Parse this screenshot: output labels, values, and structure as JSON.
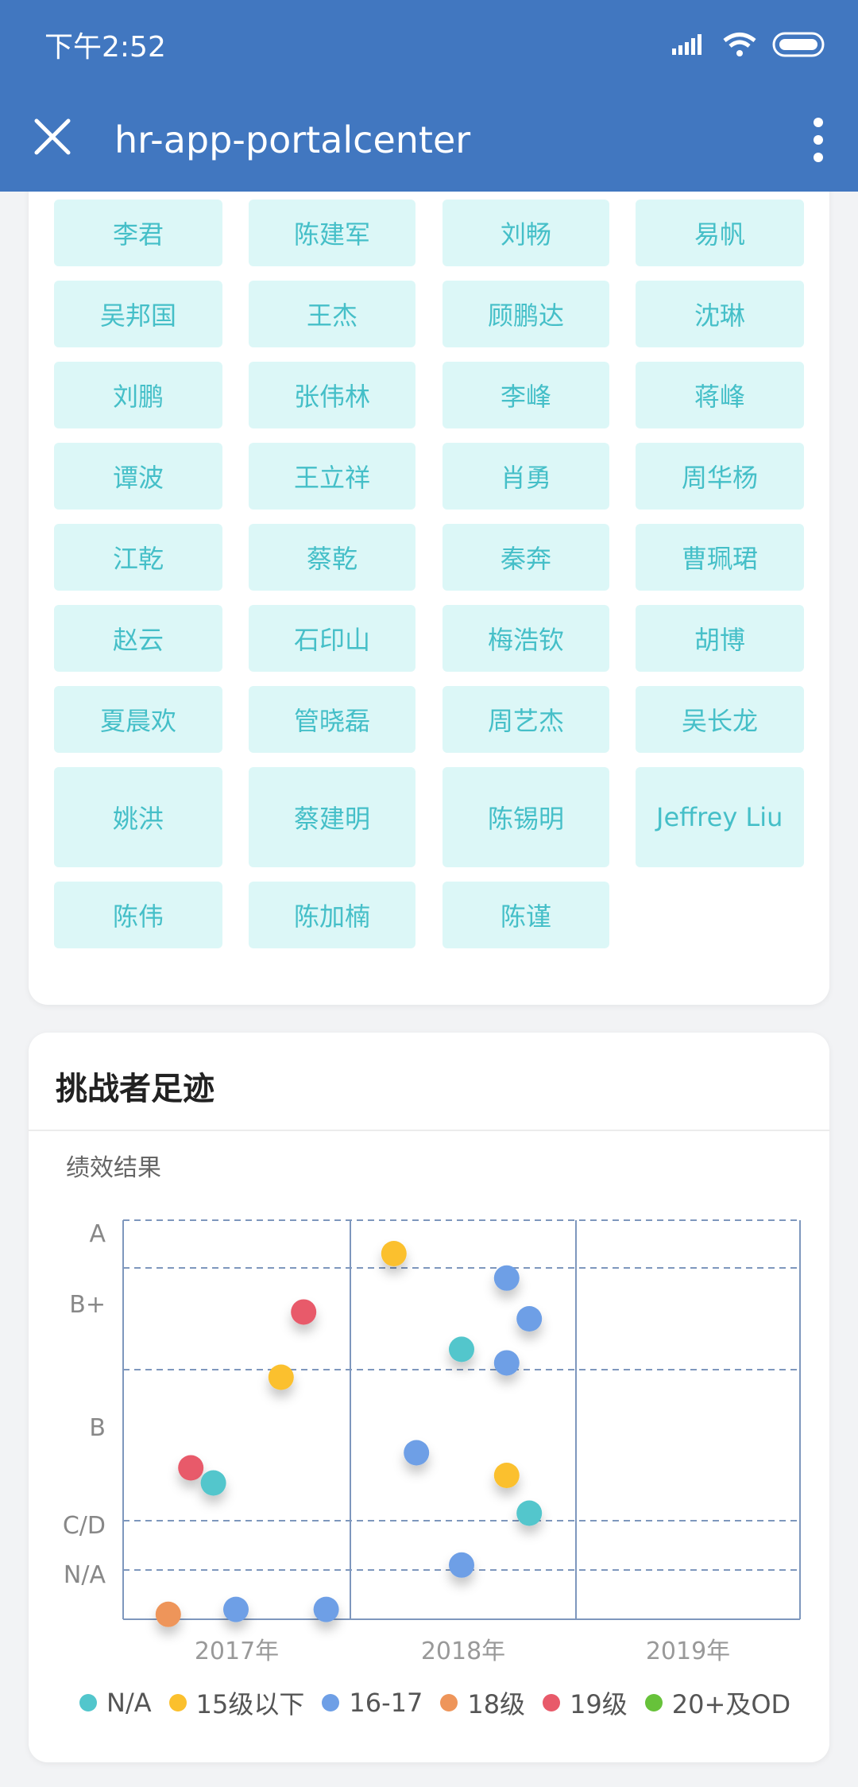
{
  "status_bar": {
    "time": "下午2:52"
  },
  "app_bar": {
    "title": "hr-app-portalcenter"
  },
  "people": {
    "rows": [
      [
        "李君",
        "陈建军",
        "刘畅",
        "易帆"
      ],
      [
        "吴邦国",
        "王杰",
        "顾鹏达",
        "沈琳"
      ],
      [
        "刘鹏",
        "张伟林",
        "李峰",
        "蒋峰"
      ],
      [
        "谭波",
        "王立祥",
        "肖勇",
        "周华杨"
      ],
      [
        "江乾",
        "蔡乾",
        "秦奔",
        "曹珮珺"
      ],
      [
        "赵云",
        "石印山",
        "梅浩钦",
        "胡博"
      ],
      [
        "夏晨欢",
        "管晓磊",
        "周艺杰",
        "吴长龙"
      ],
      [
        "姚洪",
        "蔡建明",
        "陈锡明",
        "Jeffrey Liu"
      ],
      [
        "陈伟",
        "陈加楠",
        "陈谨"
      ]
    ]
  },
  "section": {
    "title": "挑战者足迹"
  },
  "chart_data": {
    "type": "scatter",
    "ylabel": "绩效结果",
    "x_categories": [
      "2017年",
      "2018年",
      "2019年"
    ],
    "y_categories": [
      "N/A",
      "C/D",
      "B",
      "B+",
      "A"
    ],
    "legend": [
      {
        "name": "N/A",
        "color": "#52c6cc"
      },
      {
        "name": "15级以下",
        "color": "#fbc02d"
      },
      {
        "name": "16-17",
        "color": "#6e9fe6"
      },
      {
        "name": "18级",
        "color": "#ee955a"
      },
      {
        "name": "19级",
        "color": "#e85a6a"
      },
      {
        "name": "20+及OD",
        "color": "#67c23a"
      }
    ],
    "points": [
      {
        "x": 0.2,
        "y": 0.05,
        "series": "18级"
      },
      {
        "x": 0.5,
        "y": 0.1,
        "series": "16-17"
      },
      {
        "x": 0.9,
        "y": 0.1,
        "series": "16-17"
      },
      {
        "x": 0.3,
        "y": 1.35,
        "series": "19级"
      },
      {
        "x": 0.4,
        "y": 1.25,
        "series": "N/A"
      },
      {
        "x": 0.7,
        "y": 1.95,
        "series": "15级以下"
      },
      {
        "x": 0.8,
        "y": 2.85,
        "series": "19级"
      },
      {
        "x": 1.2,
        "y": 3.65,
        "series": "15级以下"
      },
      {
        "x": 1.3,
        "y": 1.45,
        "series": "16-17"
      },
      {
        "x": 1.5,
        "y": 0.55,
        "series": "16-17"
      },
      {
        "x": 1.5,
        "y": 2.3,
        "series": "N/A"
      },
      {
        "x": 1.7,
        "y": 3.35,
        "series": "16-17"
      },
      {
        "x": 1.8,
        "y": 2.75,
        "series": "16-17"
      },
      {
        "x": 1.7,
        "y": 2.1,
        "series": "16-17"
      },
      {
        "x": 1.7,
        "y": 1.3,
        "series": "15级以下"
      },
      {
        "x": 1.8,
        "y": 1.05,
        "series": "N/A"
      }
    ]
  }
}
